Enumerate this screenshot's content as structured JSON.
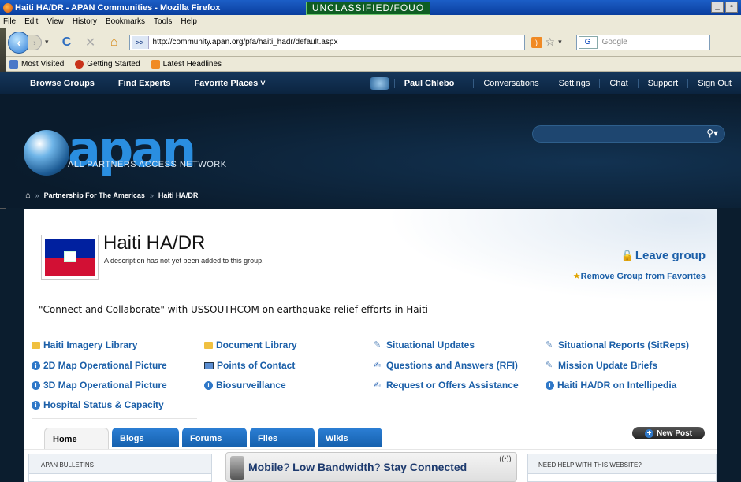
{
  "window": {
    "title": "Haiti HA/DR - APAN Communities - Mozilla Firefox",
    "classification": "UNCLASSIFIED/FOUO"
  },
  "menu": [
    "File",
    "Edit",
    "View",
    "History",
    "Bookmarks",
    "Tools",
    "Help"
  ],
  "browser": {
    "url": "http://community.apan.org/pfa/haiti_hadr/default.aspx",
    "search_placeholder": "Google",
    "bookmarks": [
      "Most Visited",
      "Getting Started",
      "Latest Headlines"
    ]
  },
  "site_nav": {
    "left": [
      "Browse Groups",
      "Find Experts",
      "Favorite Places ˅"
    ],
    "user": "Paul Chlebo",
    "right": [
      "Conversations",
      "Settings",
      "Chat",
      "Support",
      "Sign Out"
    ]
  },
  "header": {
    "logo": "apan",
    "logo_sub": "ALL PARTNERS ACCESS NETWORK",
    "breadcrumb": [
      "Partnership For The Americas",
      "Haiti HA/DR"
    ]
  },
  "group": {
    "title": "Haiti HA/DR",
    "description": "A description has not yet been added to this group.",
    "leave": "Leave group",
    "unfavorite": "Remove Group from Favorites",
    "tagline": "\"Connect and Collaborate\" with USSOUTHCOM on earthquake relief efforts in Haiti"
  },
  "links": [
    {
      "label": "Haiti Imagery Library",
      "icon": "folder-icon"
    },
    {
      "label": "Document Library",
      "icon": "folder-icon"
    },
    {
      "label": "Situational Updates",
      "icon": "pen-icon"
    },
    {
      "label": "Situational Reports (SitReps)",
      "icon": "pen-icon"
    },
    {
      "label": "2D Map Operational Picture",
      "icon": "info-icon"
    },
    {
      "label": "Points of Contact",
      "icon": "book-icon"
    },
    {
      "label": "Questions and Answers (RFI)",
      "icon": "qa-icon"
    },
    {
      "label": "Mission Update Briefs",
      "icon": "pen-icon"
    },
    {
      "label": "3D Map Operational Picture",
      "icon": "info-icon"
    },
    {
      "label": "Biosurveillance",
      "icon": "info-icon"
    },
    {
      "label": "Request or Offers Assistance",
      "icon": "qa-icon"
    },
    {
      "label": "Haiti HA/DR on Intellipedia",
      "icon": "info-icon"
    },
    {
      "label": "Hospital Status & Capacity",
      "icon": "info-icon"
    }
  ],
  "tabs": [
    "Home",
    "Blogs",
    "Forums",
    "Files",
    "Wikis"
  ],
  "new_post": "New Post",
  "panels": {
    "left": "APAN BULLETINS",
    "right": "NEED HELP WITH THIS WEBSITE?"
  },
  "banner": {
    "part1": "Mobile",
    "q1": "?",
    "part2": "Low Bandwidth",
    "q2": "?",
    "part3": "Stay Connected"
  },
  "colors": {
    "link": "#1b5fa8",
    "nav_bg": "#0b2440",
    "classification_bg": "#0e5e23"
  }
}
